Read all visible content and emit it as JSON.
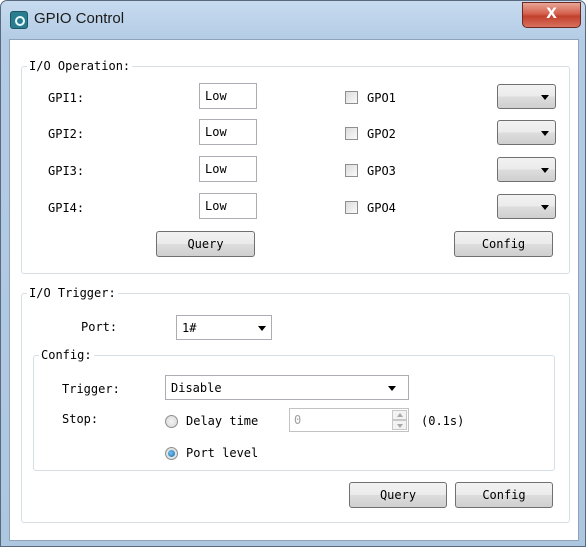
{
  "window": {
    "title": "GPIO Control",
    "close_glyph": "X"
  },
  "io_operation": {
    "group_label": "I/O Operation:",
    "inputs": [
      {
        "label": "GPI1:",
        "value": "Low"
      },
      {
        "label": "GPI2:",
        "value": "Low"
      },
      {
        "label": "GPI3:",
        "value": "Low"
      },
      {
        "label": "GPI4:",
        "value": "Low"
      }
    ],
    "outputs": [
      {
        "label": "GPO1",
        "checked": false,
        "selected": ""
      },
      {
        "label": "GPO2",
        "checked": false,
        "selected": ""
      },
      {
        "label": "GPO3",
        "checked": false,
        "selected": ""
      },
      {
        "label": "GPO4",
        "checked": false,
        "selected": ""
      }
    ],
    "query_label": "Query",
    "config_label": "Config"
  },
  "io_trigger": {
    "group_label": "I/O Trigger:",
    "port_label": "Port:",
    "port_value": "1#",
    "config": {
      "group_label": "Config:",
      "trigger_label": "Trigger:",
      "trigger_value": "Disable",
      "stop_label": "Stop:",
      "delay_label": "Delay time",
      "delay_value": "0",
      "delay_unit": "(0.1s)",
      "port_level_label": "Port level",
      "selected_stop": "Port level"
    },
    "query_label": "Query",
    "config_label": "Config"
  },
  "colors": {
    "title_bar": "#b3cbe5",
    "close_button": "#c2402c",
    "border": "#d5dfe5"
  }
}
